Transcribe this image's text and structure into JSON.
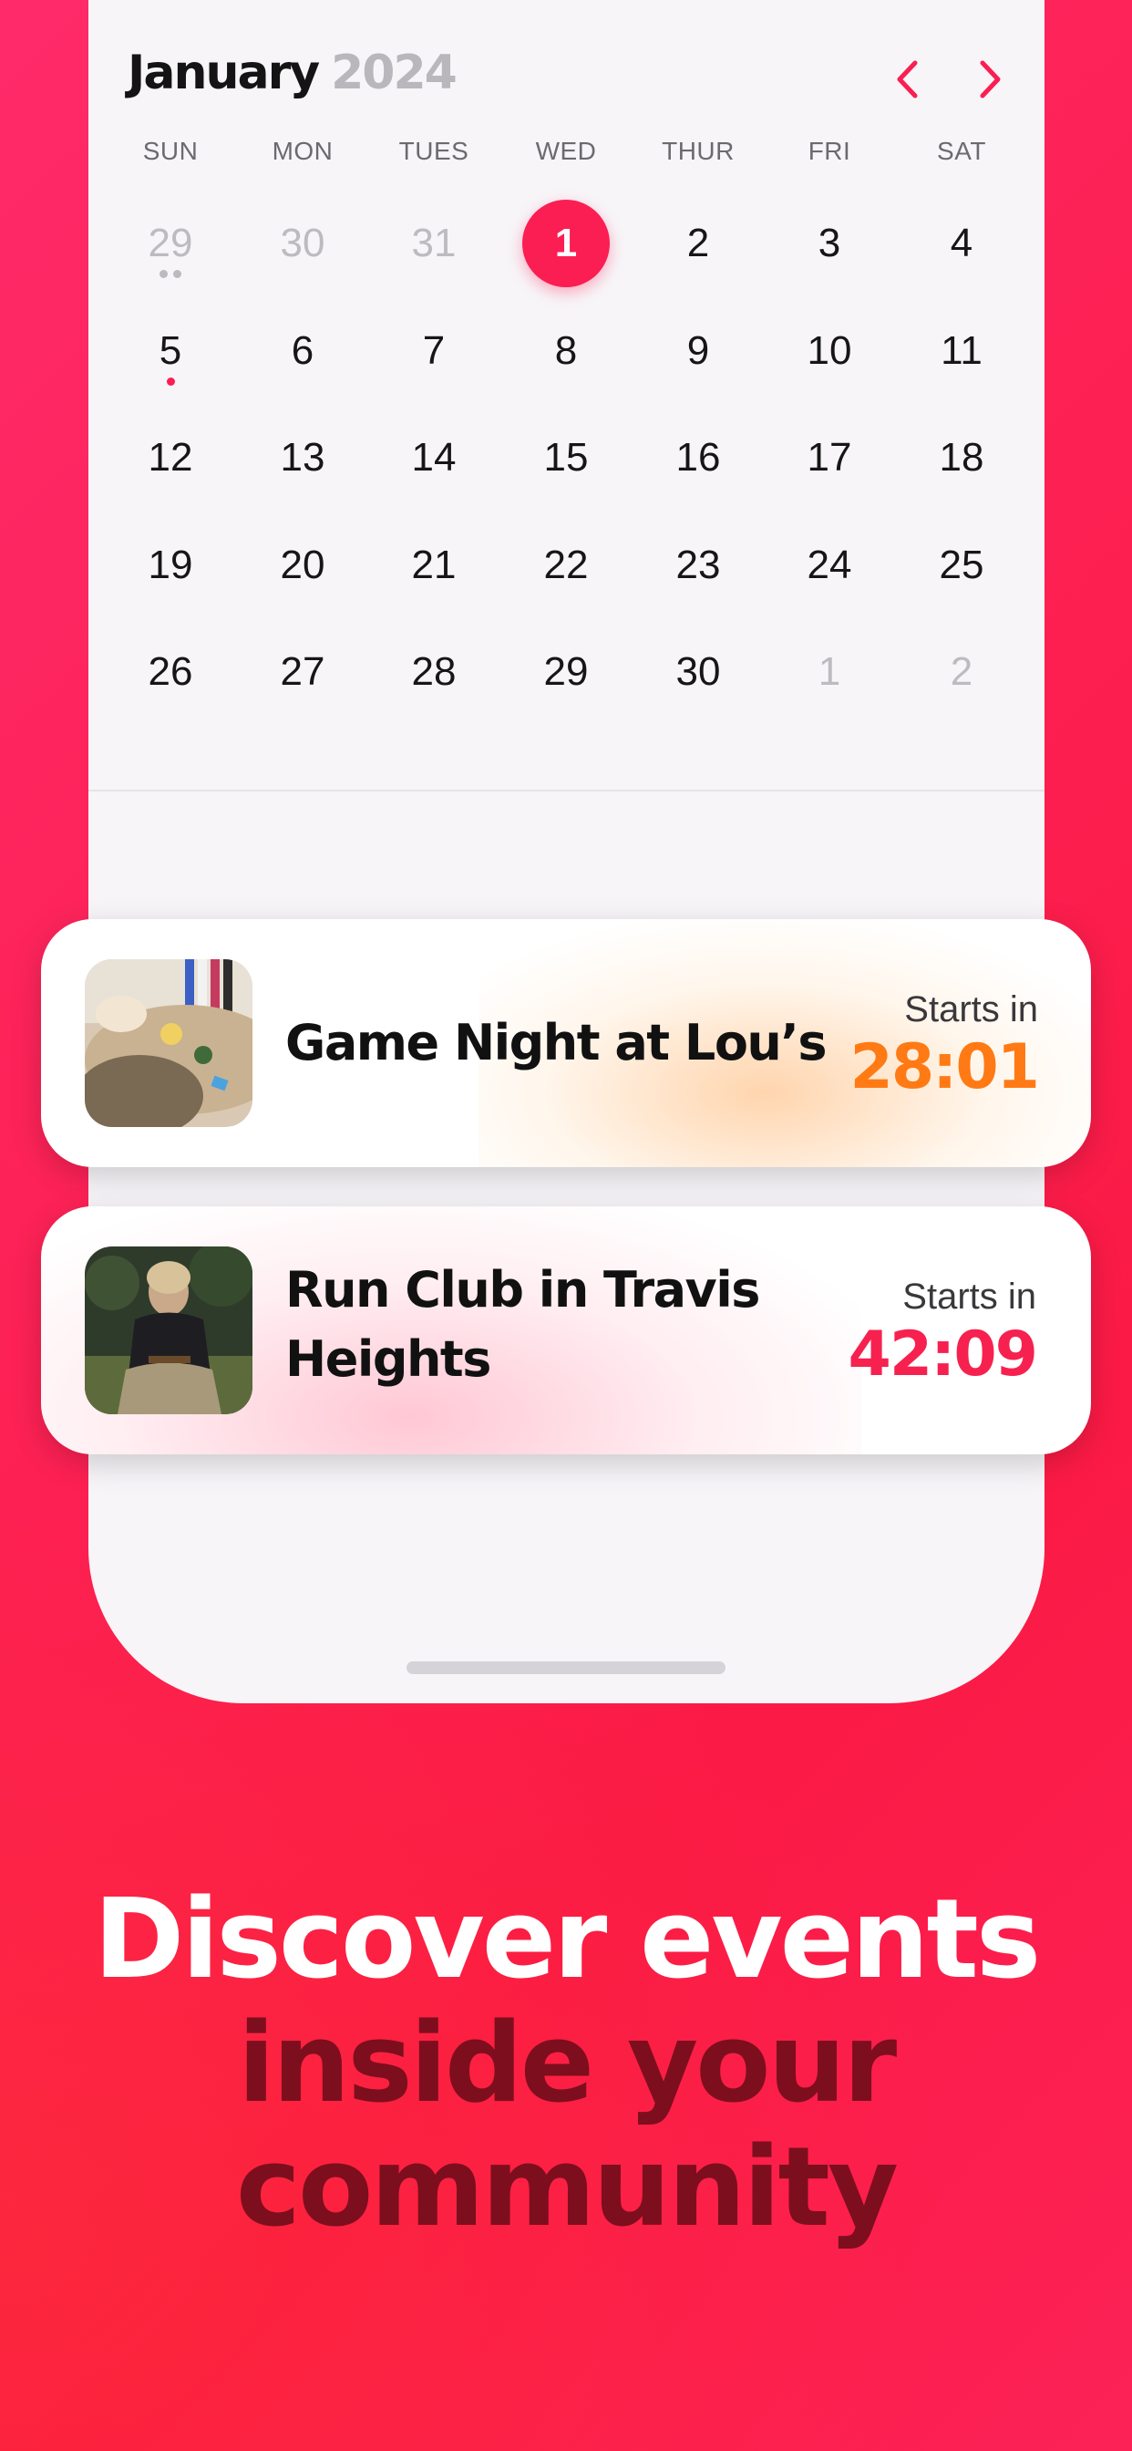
{
  "calendar": {
    "month": "January",
    "year": "2024",
    "weekdays": [
      "SUN",
      "MON",
      "TUES",
      "WED",
      "THUR",
      "FRI",
      "SAT"
    ],
    "weeks": [
      [
        "29",
        "30",
        "31",
        "1",
        "2",
        "3",
        "4"
      ],
      [
        "5",
        "6",
        "7",
        "8",
        "9",
        "10",
        "11"
      ],
      [
        "12",
        "13",
        "14",
        "15",
        "16",
        "17",
        "18"
      ],
      [
        "19",
        "20",
        "21",
        "22",
        "23",
        "24",
        "25"
      ],
      [
        "26",
        "27",
        "28",
        "29",
        "30",
        "1",
        "2"
      ]
    ],
    "selected_day": "1",
    "accent_color": "#fb1e52"
  },
  "events": [
    {
      "title": "Game Night at Lou’s",
      "starts_label": "Starts in",
      "countdown": "28:01",
      "countdown_color": "#ff7a14"
    },
    {
      "title": "Run Club in Travis Heights",
      "starts_label": "Starts in",
      "countdown": "42:09",
      "countdown_color": "#f6214f"
    }
  ],
  "headline": {
    "line1": "Discover events",
    "line2": "inside your",
    "line3": "community"
  },
  "colors": {
    "background": "#fd2154",
    "headline_dark": "#7d0e1d"
  }
}
